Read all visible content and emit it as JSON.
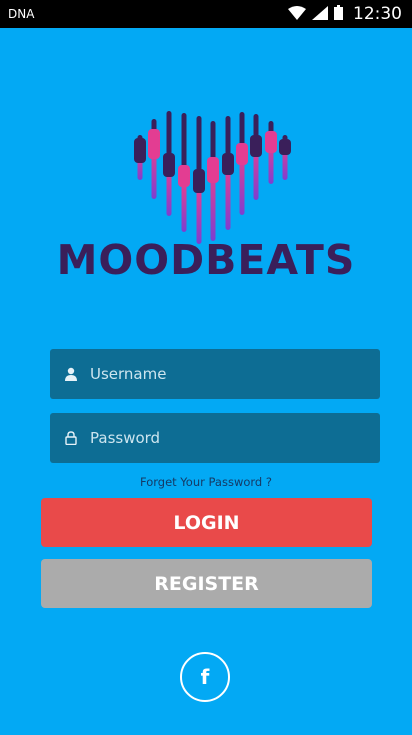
{
  "status_bar": {
    "carrier": "DNA",
    "time": "12:30",
    "icons": [
      "wifi-icon",
      "signal-icon",
      "battery-icon"
    ]
  },
  "app": {
    "brand_name": "MOODBEATS",
    "logo_icon": "heart-equalizer-icon"
  },
  "form": {
    "username": {
      "placeholder": "Username",
      "value": "",
      "icon": "user-icon"
    },
    "password": {
      "placeholder": "Password",
      "value": "",
      "icon": "lock-icon"
    },
    "forgot_link": "Forget Your Password ?",
    "login_label": "LOGIN",
    "register_label": "REGISTER"
  },
  "social": {
    "facebook_glyph": "f",
    "icon": "facebook-icon"
  },
  "colors": {
    "background": "#03a9f4",
    "field": "#0d6d94",
    "login_button": "#e94a4a",
    "register_button": "#ababab",
    "brand_text": "#3a1f5a",
    "logo_dark": "#3a1f5a",
    "logo_pink": "#e33d92",
    "logo_purple": "#7d3fd0"
  }
}
